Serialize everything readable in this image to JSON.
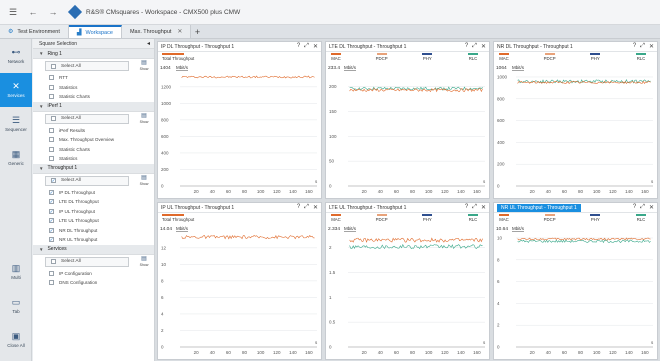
{
  "titlebar": {
    "title": "R&S® CMsquares - Workspace - CMX500 plus CMW",
    "menu_icon": "hamburger-icon",
    "back_icon": "arrow-left-icon",
    "forward_icon": "arrow-right-icon"
  },
  "tabs": [
    {
      "label": "Test Environment",
      "icon": "gear-icon",
      "active": false,
      "closable": false
    },
    {
      "label": "Workspace",
      "icon": "chart-icon",
      "active": true,
      "closable": false
    },
    {
      "label": "Max. Throughput",
      "icon": "",
      "active": false,
      "closable": true
    }
  ],
  "rail": [
    {
      "label": "Network",
      "icon": "network-icon",
      "active": false
    },
    {
      "label": "Services",
      "icon": "tools-icon",
      "active": true
    },
    {
      "label": "Sequencer",
      "icon": "list-icon",
      "active": false
    },
    {
      "label": "Generic",
      "icon": "grid-icon",
      "active": false
    },
    {
      "label": "Multi",
      "icon": "multi-icon",
      "active": false
    },
    {
      "label": "Tab",
      "icon": "tab-icon",
      "active": false
    },
    {
      "label": "Close All",
      "icon": "close-all-icon",
      "active": false
    }
  ],
  "panel": {
    "title": "Square Selection",
    "sections": [
      {
        "name": "Ring 1",
        "select_all": "Select All",
        "show": "Show",
        "items": [
          {
            "label": "RTT",
            "checked": false
          },
          {
            "label": "Statistics",
            "checked": false
          },
          {
            "label": "Statistic Charts",
            "checked": false
          }
        ]
      },
      {
        "name": "iPerf 1",
        "select_all": "Select All",
        "show": "Show",
        "items": [
          {
            "label": "iPerf Results",
            "checked": false
          },
          {
            "label": "Max. Throughput Overview",
            "checked": false
          },
          {
            "label": "Statistic Charts",
            "checked": false
          },
          {
            "label": "Statistics",
            "checked": false
          }
        ]
      },
      {
        "name": "Throughput 1",
        "select_all": "Select All",
        "show": "Show",
        "items": [
          {
            "label": "IP DL Throughput",
            "checked": true
          },
          {
            "label": "LTE DL Throughput",
            "checked": true
          },
          {
            "label": "IP UL Throughput",
            "checked": true
          },
          {
            "label": "LTE UL Throughput",
            "checked": true
          },
          {
            "label": "NR DL Throughput",
            "checked": true
          },
          {
            "label": "NR UL Throughput",
            "checked": true
          }
        ]
      },
      {
        "name": "Services",
        "select_all": "Select All",
        "show": "Show",
        "items": [
          {
            "label": "IP Configuration",
            "checked": false
          },
          {
            "label": "DNS Configuration",
            "checked": false
          }
        ]
      }
    ]
  },
  "chart_data": [
    {
      "type": "line",
      "title": "IP DL Throughput - Throughput 1",
      "highlighted": false,
      "legend": [
        {
          "name": "Total Throughput",
          "color": "#e06a2b"
        }
      ],
      "y_readout": "1404",
      "unit": "Mbit/s",
      "ylim": [
        0,
        1404
      ],
      "yticks": [
        0,
        200,
        400,
        600,
        800,
        1000,
        1200
      ],
      "xlim": [
        0,
        170
      ],
      "xticks": [
        20,
        40,
        60,
        80,
        100,
        120,
        140,
        160
      ],
      "xlabel": "s",
      "series": [
        {
          "color": "#e06a2b",
          "level": 1320,
          "noise": 12
        }
      ]
    },
    {
      "type": "line",
      "title": "LTE DL Throughput - Throughput 1",
      "highlighted": false,
      "legend": [
        {
          "name": "MAC",
          "color": "#e06a2b"
        },
        {
          "name": "PDCP",
          "color": "#e8a27a"
        },
        {
          "name": "PHY",
          "color": "#2f4f8f"
        },
        {
          "name": "RLC",
          "color": "#3aa88a"
        }
      ],
      "y_readout": "233.4",
      "unit": "Mbit/s",
      "ylim": [
        0,
        233.4
      ],
      "yticks": [
        0,
        50,
        100,
        150,
        200
      ],
      "xlim": [
        0,
        170
      ],
      "xticks": [
        20,
        40,
        60,
        80,
        100,
        120,
        140,
        160
      ],
      "xlabel": "s",
      "series": [
        {
          "color": "#3aa88a",
          "level": 196,
          "noise": 3
        },
        {
          "color": "#e06a2b",
          "level": 193,
          "noise": 3
        }
      ]
    },
    {
      "type": "line",
      "title": "NR DL Throughput - Throughput 1",
      "highlighted": false,
      "legend": [
        {
          "name": "MAC",
          "color": "#e06a2b"
        },
        {
          "name": "PDCP",
          "color": "#e8a27a"
        },
        {
          "name": "PHY",
          "color": "#2f4f8f"
        },
        {
          "name": "RLC",
          "color": "#3aa88a"
        }
      ],
      "y_readout": "1064",
      "unit": "Mbit/s",
      "ylim": [
        0,
        1064
      ],
      "yticks": [
        0,
        200,
        400,
        600,
        800,
        1000
      ],
      "xlim": [
        0,
        170
      ],
      "xticks": [
        20,
        40,
        60,
        80,
        100,
        120,
        140,
        160
      ],
      "xlabel": "s",
      "series": [
        {
          "color": "#3aa88a",
          "level": 960,
          "noise": 15
        },
        {
          "color": "#e06a2b",
          "level": 950,
          "noise": 10
        }
      ]
    },
    {
      "type": "line",
      "title": "IP UL Throughput - Throughput 1",
      "highlighted": false,
      "legend": [
        {
          "name": "Total Throughput",
          "color": "#e06a2b"
        }
      ],
      "y_readout": "14.04",
      "unit": "Mbit/s",
      "ylim": [
        0,
        14.04
      ],
      "yticks": [
        0,
        2,
        4,
        6,
        8,
        10,
        12
      ],
      "xlim": [
        0,
        170
      ],
      "xticks": [
        20,
        40,
        60,
        80,
        100,
        120,
        140,
        160
      ],
      "xlabel": "s",
      "series": [
        {
          "color": "#e06a2b",
          "level": 13.3,
          "noise": 0.2
        }
      ]
    },
    {
      "type": "line",
      "title": "LTE UL Throughput - Throughput 1",
      "highlighted": false,
      "legend": [
        {
          "name": "MAC",
          "color": "#e06a2b"
        },
        {
          "name": "PDCP",
          "color": "#e8a27a"
        },
        {
          "name": "PHY",
          "color": "#2f4f8f"
        },
        {
          "name": "RLC",
          "color": "#3aa88a"
        }
      ],
      "y_readout": "2.334",
      "unit": "Mbit/s",
      "ylim": [
        0,
        2.334
      ],
      "yticks": [
        0,
        0.5,
        1,
        1.5,
        2
      ],
      "xlim": [
        0,
        170
      ],
      "xticks": [
        20,
        40,
        60,
        80,
        100,
        120,
        140,
        160
      ],
      "xlabel": "s",
      "series": [
        {
          "color": "#e06a2b",
          "level": 2.15,
          "noise": 0.04
        },
        {
          "color": "#3aa88a",
          "level": 2.02,
          "noise": 0.04
        }
      ]
    },
    {
      "type": "line",
      "title": "NR UL Throughput - Throughput 1",
      "highlighted": true,
      "legend": [
        {
          "name": "MAC",
          "color": "#e06a2b"
        },
        {
          "name": "PDCP",
          "color": "#e8a27a"
        },
        {
          "name": "PHY",
          "color": "#2f4f8f"
        },
        {
          "name": "RLC",
          "color": "#3aa88a"
        }
      ],
      "y_readout": "10.64",
      "unit": "Mbit/s",
      "ylim": [
        0,
        10.64
      ],
      "yticks": [
        0,
        2,
        4,
        6,
        8,
        10
      ],
      "xlim": [
        0,
        170
      ],
      "xticks": [
        20,
        40,
        60,
        80,
        100,
        120,
        140,
        160
      ],
      "xlabel": "s",
      "series": [
        {
          "color": "#3aa88a",
          "level": 9.7,
          "noise": 0.12
        },
        {
          "color": "#e06a2b",
          "level": 9.9,
          "noise": 0.1
        }
      ]
    }
  ]
}
